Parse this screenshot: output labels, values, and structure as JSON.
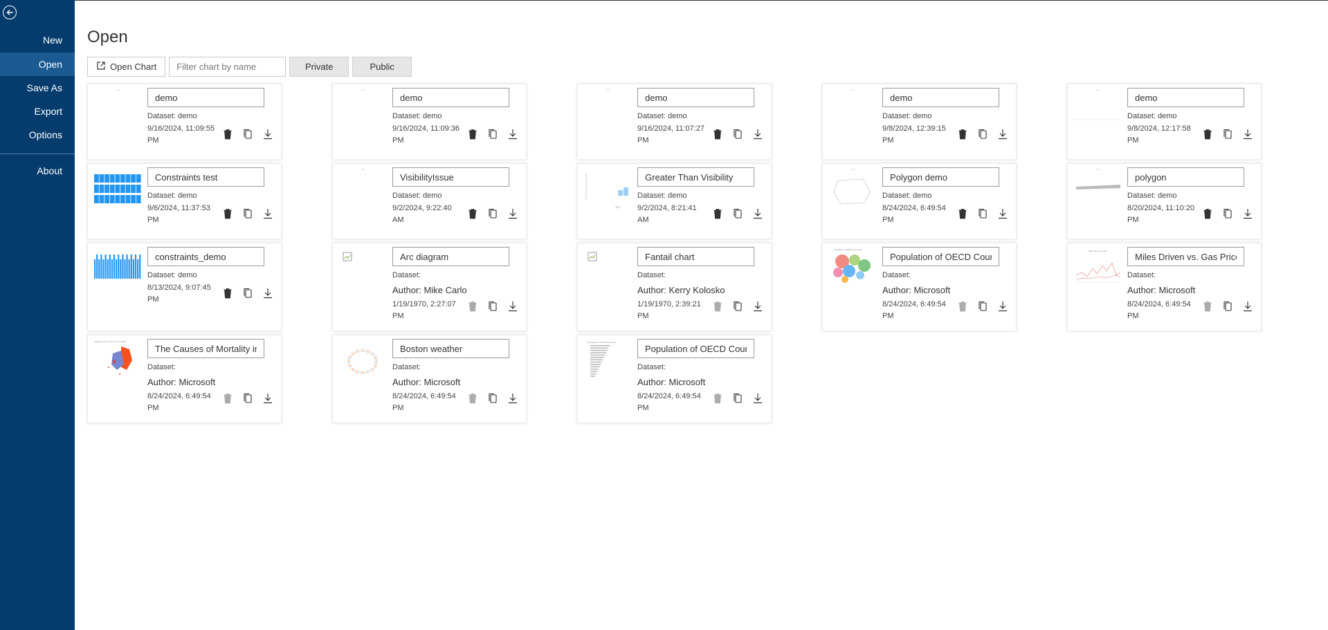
{
  "sidebar": {
    "items": [
      {
        "label": "New",
        "active": false
      },
      {
        "label": "Open",
        "active": true
      },
      {
        "label": "Save As",
        "active": false
      },
      {
        "label": "Export",
        "active": false
      },
      {
        "label": "Options",
        "active": false
      },
      {
        "label": "About",
        "active": false
      }
    ]
  },
  "main": {
    "title": "Open",
    "open_chart_label": "Open Chart",
    "filter_placeholder": "Filter chart by name",
    "private_label": "Private",
    "public_label": "Public"
  },
  "colors": {
    "sidebar_bg": "#063c6d",
    "sidebar_active": "#1b5a92",
    "accent_blue": "#2196f3"
  },
  "charts": [
    {
      "name": "demo",
      "dataset": "Dataset: demo",
      "author": "",
      "date": "9/16/2024, 11:09:55 PM",
      "thumb": "blank",
      "deletable": true
    },
    {
      "name": "demo",
      "dataset": "Dataset: demo",
      "author": "",
      "date": "9/16/2024, 11:09:36 PM",
      "thumb": "blank",
      "deletable": true
    },
    {
      "name": "demo",
      "dataset": "Dataset: demo",
      "author": "",
      "date": "9/16/2024, 11:07:27 PM",
      "thumb": "blank",
      "deletable": true
    },
    {
      "name": "demo",
      "dataset": "Dataset: demo",
      "author": "",
      "date": "9/8/2024, 12:39:15 PM",
      "thumb": "blank",
      "deletable": true
    },
    {
      "name": "demo",
      "dataset": "Dataset: demo",
      "author": "",
      "date": "9/8/2024, 12:17:58 PM",
      "thumb": "dotline",
      "deletable": true
    },
    {
      "name": "Constraints test",
      "dataset": "Dataset: demo",
      "author": "",
      "date": "9/6/2024, 11:37:53 PM",
      "thumb": "bluegrid",
      "deletable": true
    },
    {
      "name": "VisibilityIssue",
      "dataset": "Dataset: demo",
      "author": "",
      "date": "9/2/2024, 9:22:40 AM",
      "thumb": "blank",
      "deletable": true
    },
    {
      "name": "Greater Than Visibility",
      "dataset": "Dataset: demo",
      "author": "",
      "date": "9/2/2024, 8:21:41 AM",
      "thumb": "smallbars",
      "deletable": true
    },
    {
      "name": "Polygon demo",
      "dataset": "Dataset: demo",
      "author": "",
      "date": "8/24/2024, 6:49:54 PM",
      "thumb": "polygon",
      "deletable": true
    },
    {
      "name": "polygon",
      "dataset": "Dataset: demo",
      "author": "",
      "date": "8/20/2024, 11:10:20 PM",
      "thumb": "flatbar",
      "deletable": true
    },
    {
      "name": "constraints_demo",
      "dataset": "Dataset: demo",
      "author": "",
      "date": "8/13/2024, 9:07:45 PM",
      "thumb": "bluebars",
      "deletable": true
    },
    {
      "name": "Arc diagram",
      "dataset": "Dataset:",
      "author": "Author: Mike Carlo",
      "date": "1/19/1970, 2:27:07 PM",
      "thumb": "broken",
      "deletable": false
    },
    {
      "name": "Fantail chart",
      "dataset": "Dataset:",
      "author": "Author: Kerry Kolosko",
      "date": "1/19/1970, 2:39:21 PM",
      "thumb": "broken",
      "deletable": false
    },
    {
      "name": "Population of OECD Countries",
      "dataset": "Dataset:",
      "author": "Author: Microsoft",
      "date": "8/24/2024, 6:49:54 PM",
      "thumb": "bubbles",
      "deletable": false
    },
    {
      "name": "Miles Driven vs. Gas Prices",
      "dataset": "Dataset:",
      "author": "Author: Microsoft",
      "date": "8/24/2024, 6:49:54 PM",
      "thumb": "lines",
      "deletable": false
    },
    {
      "name": "The Causes of Mortality in",
      "dataset": "Dataset:",
      "author": "Author: Microsoft",
      "date": "8/24/2024, 6:49:54 PM",
      "thumb": "mortality",
      "deletable": false
    },
    {
      "name": "Boston weather",
      "dataset": "Dataset:",
      "author": "Author: Microsoft",
      "date": "8/24/2024, 6:49:54 PM",
      "thumb": "ring",
      "deletable": false
    },
    {
      "name": "Population of OECD Countries",
      "dataset": "Dataset:",
      "author": "Author: Microsoft",
      "date": "8/24/2024, 6:49:54 PM",
      "thumb": "hbars",
      "deletable": false
    }
  ]
}
